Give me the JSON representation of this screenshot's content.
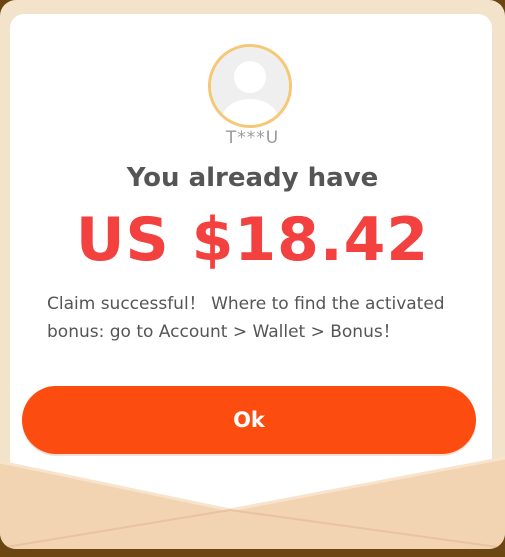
{
  "dialog": {
    "username": "T***U",
    "headline": "You already have",
    "amount": "US $18.42",
    "message": "Claim successful！ Where to find the activated bonus: go to Account > Wallet > Bonus！",
    "ok_label": "Ok"
  },
  "colors": {
    "accent": "#fd4c0f",
    "amount": "#f2413f",
    "avatar_ring": "#f6c774",
    "envelope": "#f2d4b3"
  },
  "icons": {
    "avatar": "user-silhouette-icon"
  }
}
